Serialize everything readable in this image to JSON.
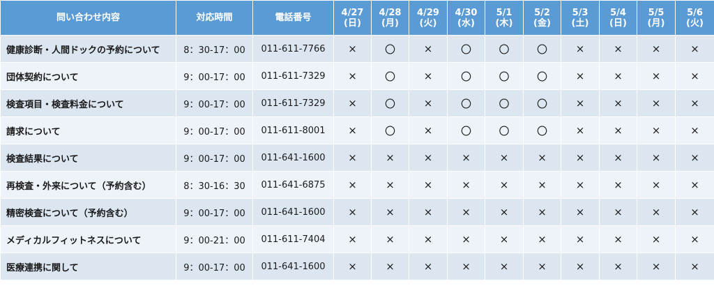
{
  "headers": {
    "inquiry": "問い合わせ内容",
    "hours": "対応時間",
    "phone": "電話番号"
  },
  "dates": [
    {
      "date": "4/27",
      "weekday": "(日)"
    },
    {
      "date": "4/28",
      "weekday": "(月)"
    },
    {
      "date": "4/29",
      "weekday": "(火)"
    },
    {
      "date": "4/30",
      "weekday": "(水)"
    },
    {
      "date": "5/1",
      "weekday": "(木)"
    },
    {
      "date": "5/2",
      "weekday": "(金)"
    },
    {
      "date": "5/3",
      "weekday": "(土)"
    },
    {
      "date": "5/4",
      "weekday": "(日)"
    },
    {
      "date": "5/5",
      "weekday": "(月)"
    },
    {
      "date": "5/6",
      "weekday": "(火)"
    }
  ],
  "rows": [
    {
      "topic": "健康診断・人間ドックの予約について",
      "hours": "8：30-17：00",
      "phone": "011-611-7766",
      "marks": [
        "×",
        "〇",
        "×",
        "〇",
        "〇",
        "〇",
        "×",
        "×",
        "×",
        "×"
      ]
    },
    {
      "topic": "団体契約について",
      "hours": "9：00-17：00",
      "phone": "011-611-7329",
      "marks": [
        "×",
        "〇",
        "×",
        "〇",
        "〇",
        "〇",
        "×",
        "×",
        "×",
        "×"
      ]
    },
    {
      "topic": "検査項目・検査料金について",
      "hours": "9：00-17：00",
      "phone": "011-611-7329",
      "marks": [
        "×",
        "〇",
        "×",
        "〇",
        "〇",
        "〇",
        "×",
        "×",
        "×",
        "×"
      ]
    },
    {
      "topic": "請求について",
      "hours": "9：00-17：00",
      "phone": "011-611-8001",
      "marks": [
        "×",
        "〇",
        "×",
        "〇",
        "〇",
        "〇",
        "×",
        "×",
        "×",
        "×"
      ]
    },
    {
      "topic": "検査結果について",
      "hours": "9：00-17：00",
      "phone": "011-641-1600",
      "marks": [
        "×",
        "×",
        "×",
        "×",
        "×",
        "×",
        "×",
        "×",
        "×",
        "×"
      ]
    },
    {
      "topic": "再検査・外来について（予約含む）",
      "hours": "8：30-16：30",
      "phone": "011-641-6875",
      "marks": [
        "×",
        "×",
        "×",
        "×",
        "×",
        "×",
        "×",
        "×",
        "×",
        "×"
      ]
    },
    {
      "topic": "精密検査について（予約含む）",
      "hours": "9：00-17：00",
      "phone": "011-641-1600",
      "marks": [
        "×",
        "×",
        "×",
        "×",
        "×",
        "×",
        "×",
        "×",
        "×",
        "×"
      ]
    },
    {
      "topic": "メディカルフィットネスについて",
      "hours": "9：00-21：00",
      "phone": "011-611-7404",
      "marks": [
        "×",
        "×",
        "×",
        "×",
        "×",
        "×",
        "×",
        "×",
        "×",
        "×"
      ]
    },
    {
      "topic": "医療連携に関して",
      "hours": "9：00-17：00",
      "phone": "011-641-1600",
      "marks": [
        "×",
        "×",
        "×",
        "×",
        "×",
        "×",
        "×",
        "×",
        "×",
        "×"
      ]
    }
  ]
}
